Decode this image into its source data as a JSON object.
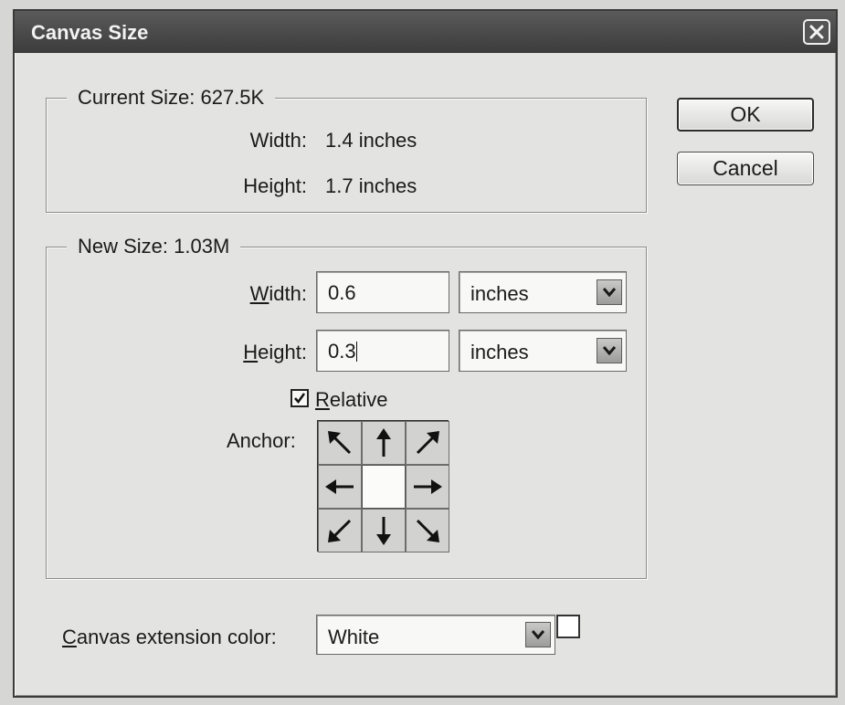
{
  "window": {
    "title": "Canvas Size",
    "close_icon": "close-icon"
  },
  "current_size": {
    "legend": "Current Size: 627.5K",
    "width_label": "Width:",
    "width_value": "1.4 inches",
    "height_label": "Height:",
    "height_value": "1.7 inches"
  },
  "new_size": {
    "legend": "New Size: 1.03M",
    "width_label_first": "W",
    "width_label_rest": "idth:",
    "width_value": "0.6",
    "width_unit": "inches",
    "height_label_first": "H",
    "height_label_rest": "eight:",
    "height_value": "0.3",
    "height_unit": "inches",
    "relative_label_first": "R",
    "relative_label_rest": "elative",
    "relative_checked": true,
    "anchor_label": "Anchor:",
    "anchor_icons": [
      "arrow-nw-icon",
      "arrow-n-icon",
      "arrow-ne-icon",
      "arrow-w-icon",
      "anchor-center",
      "arrow-e-icon",
      "arrow-sw-icon",
      "arrow-s-icon",
      "arrow-se-icon"
    ]
  },
  "buttons": {
    "ok": "OK",
    "cancel": "Cancel"
  },
  "extension": {
    "label_first": "C",
    "label_rest": "anvas extension color:",
    "value": "White",
    "swatch_color": "#ffffff"
  }
}
